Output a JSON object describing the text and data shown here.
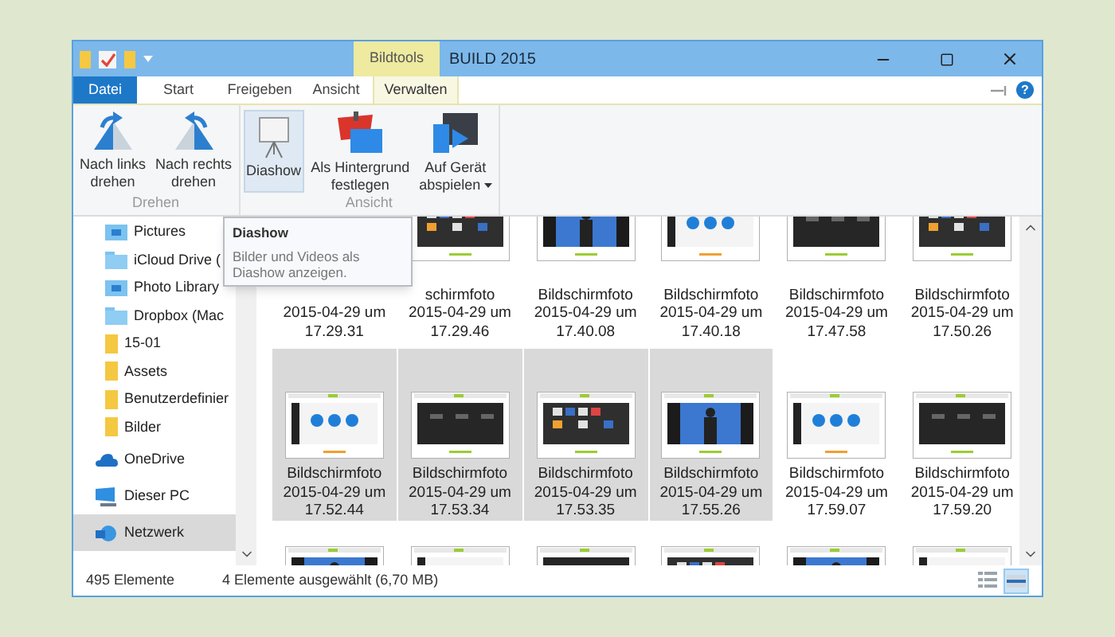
{
  "window": {
    "title": "BUILD 2015",
    "context_tab": "Bildtools",
    "help": "?"
  },
  "ribbon_tabs": [
    {
      "label": "Datei",
      "kind": "file",
      "selected": false
    },
    {
      "label": "Start",
      "kind": "plain",
      "selected": false
    },
    {
      "label": "Freigeben",
      "kind": "plain",
      "selected": false
    },
    {
      "label": "Ansicht",
      "kind": "plain",
      "selected": false
    },
    {
      "label": "Verwalten",
      "kind": "contextual",
      "selected": true
    }
  ],
  "ribbon_groups": [
    {
      "label": "Drehen",
      "buttons": [
        {
          "lines": [
            "Nach links",
            "drehen"
          ],
          "kind": "rotate-left",
          "selected": false
        },
        {
          "lines": [
            "Nach rechts",
            "drehen"
          ],
          "kind": "rotate-right",
          "selected": false
        }
      ]
    },
    {
      "label": "Ansicht",
      "buttons": [
        {
          "lines": [
            "Diashow"
          ],
          "kind": "slideshow",
          "selected": true
        },
        {
          "lines": [
            "Als Hintergrund",
            "festlegen"
          ],
          "kind": "wallpaper",
          "selected": false
        },
        {
          "lines": [
            "Auf Gerät",
            "abspielen"
          ],
          "kind": "cast",
          "selected": false,
          "dropdown": true
        }
      ]
    }
  ],
  "tooltip": {
    "title": "Diashow",
    "text": "Bilder und Videos als Diashow anzeigen."
  },
  "nav": [
    {
      "label": "Pictures",
      "kind": "library",
      "selected": false
    },
    {
      "label": "iCloud Drive (",
      "kind": "cloud-folder",
      "selected": false
    },
    {
      "label": "Photo Library",
      "kind": "library",
      "selected": false
    },
    {
      "label": "Dropbox (Mac",
      "kind": "cloud-folder",
      "selected": false
    },
    {
      "label": "15-01",
      "kind": "folder",
      "selected": false
    },
    {
      "label": "Assets",
      "kind": "folder",
      "selected": false
    },
    {
      "label": "Benutzerdefinier",
      "kind": "folder",
      "selected": false
    },
    {
      "label": "Bilder",
      "kind": "folder",
      "selected": false
    },
    {
      "label": "OneDrive",
      "kind": "onedrive",
      "selected": false
    },
    {
      "label": "Dieser PC",
      "kind": "pc",
      "selected": false
    },
    {
      "label": "Netzwerk",
      "kind": "network",
      "selected": true
    }
  ],
  "files": [
    {
      "lines": [
        "2015-04-29 um",
        "17.29.31"
      ],
      "selected": false
    },
    {
      "lines": [
        "schirmfoto",
        "2015-04-29 um",
        "17.29.46"
      ],
      "selected": false
    },
    {
      "lines": [
        "Bildschirmfoto",
        "2015-04-29 um",
        "17.40.08"
      ],
      "selected": false
    },
    {
      "lines": [
        "Bildschirmfoto",
        "2015-04-29 um",
        "17.40.18"
      ],
      "selected": false
    },
    {
      "lines": [
        "Bildschirmfoto",
        "2015-04-29 um",
        "17.47.58"
      ],
      "selected": false
    },
    {
      "lines": [
        "Bildschirmfoto",
        "2015-04-29 um",
        "17.50.26"
      ],
      "selected": false
    },
    {
      "lines": [
        "Bildschirmfoto",
        "2015-04-29 um",
        "17.52.44"
      ],
      "selected": true
    },
    {
      "lines": [
        "Bildschirmfoto",
        "2015-04-29 um",
        "17.53.34"
      ],
      "selected": true
    },
    {
      "lines": [
        "Bildschirmfoto",
        "2015-04-29 um",
        "17.53.35"
      ],
      "selected": true
    },
    {
      "lines": [
        "Bildschirmfoto",
        "2015-04-29 um",
        "17.55.26"
      ],
      "selected": true
    },
    {
      "lines": [
        "Bildschirmfoto",
        "2015-04-29 um",
        "17.59.07"
      ],
      "selected": false
    },
    {
      "lines": [
        "Bildschirmfoto",
        "2015-04-29 um",
        "17.59.20"
      ],
      "selected": false
    },
    {
      "selected": false
    },
    {
      "selected": false
    },
    {
      "selected": false
    },
    {
      "selected": false
    },
    {
      "selected": false
    },
    {
      "selected": false
    }
  ],
  "status_bar": {
    "count": "495 Elemente",
    "selection": "4 Elemente ausgewählt (6,70 MB)"
  },
  "views": [
    {
      "kind": "details",
      "selected": false
    },
    {
      "kind": "large-icons",
      "selected": true
    }
  ]
}
